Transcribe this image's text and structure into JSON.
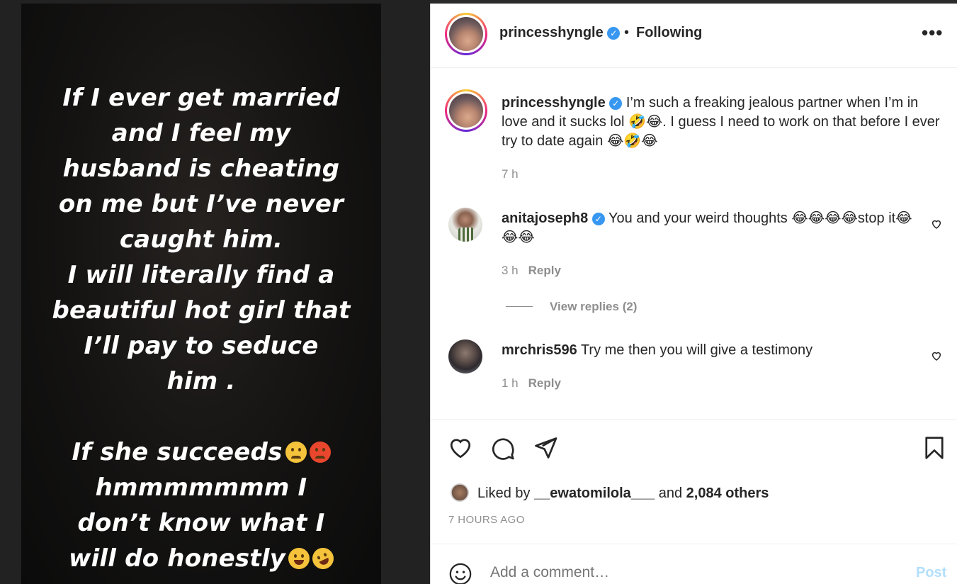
{
  "story": {
    "lines": [
      "If I ever get married",
      "and I feel my",
      "husband is cheating",
      "on me but I’ve never",
      "caught him.",
      "I will literally find a",
      "beautiful hot girl that",
      "I’ll pay to seduce",
      "him .",
      "If she succeeds",
      "hmmmmmmm I",
      "don’t know what I",
      "will do honestly"
    ]
  },
  "header": {
    "username": "princesshyngle",
    "separator": "•",
    "follow_status": "Following",
    "more": "•••"
  },
  "caption": {
    "username": "princesshyngle",
    "text": "I’m such a freaking jealous partner when I’m in love and it sucks lol 🤣😂. I guess I need to work on that before I ever try to date again 😂🤣😂",
    "time": "7 h"
  },
  "comments": [
    {
      "username": "anitajoseph8",
      "text": "You and your weird thoughts 😂😂😂😂stop it😂😂😂",
      "time": "3 h",
      "reply": "Reply"
    },
    {
      "username": "mrchris596",
      "text": "Try me then you will give a testimony",
      "time": "1 h",
      "reply": "Reply"
    }
  ],
  "view_replies": "View replies (2)",
  "likes": {
    "prefix": "Liked by",
    "user": "__ewatomilola___",
    "middle": "and",
    "others": "2,084 others"
  },
  "timestamp": "7 HOURS AGO",
  "add_comment": {
    "placeholder": "Add a comment…",
    "post_label": "Post"
  },
  "icons": [
    "heart-icon",
    "comment-icon",
    "share-icon",
    "bookmark-icon",
    "smiley-icon",
    "verified-icon",
    "more-icon"
  ]
}
